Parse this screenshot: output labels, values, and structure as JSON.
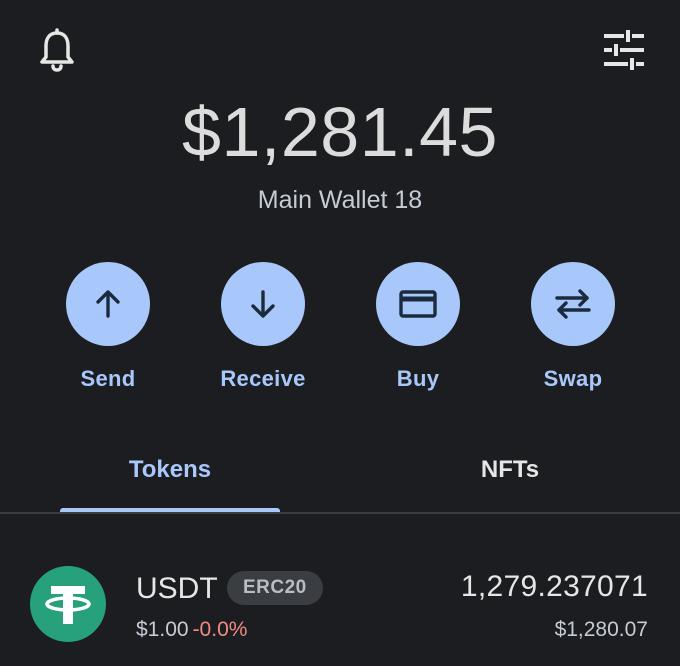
{
  "header": {
    "notifications_icon": "bell-icon",
    "settings_icon": "sliders-icon"
  },
  "balance": {
    "amount": "$1,281.45",
    "wallet_name": "Main Wallet 18"
  },
  "actions": [
    {
      "label": "Send",
      "icon": "arrow-up-icon"
    },
    {
      "label": "Receive",
      "icon": "arrow-down-icon"
    },
    {
      "label": "Buy",
      "icon": "card-icon"
    },
    {
      "label": "Swap",
      "icon": "swap-arrows-icon"
    }
  ],
  "tabs": [
    {
      "label": "Tokens",
      "active": true
    },
    {
      "label": "NFTs",
      "active": false
    }
  ],
  "tokens": [
    {
      "symbol": "USDT",
      "badge": "ERC20",
      "price": "$1.00",
      "change": "-0.0%",
      "amount": "1,279.237071",
      "value": "$1,280.07",
      "icon": "tether-icon"
    }
  ],
  "colors": {
    "background": "#1c1d20",
    "accent": "#a8c8fb",
    "negative": "#f28b82",
    "tether": "#26a17b"
  }
}
